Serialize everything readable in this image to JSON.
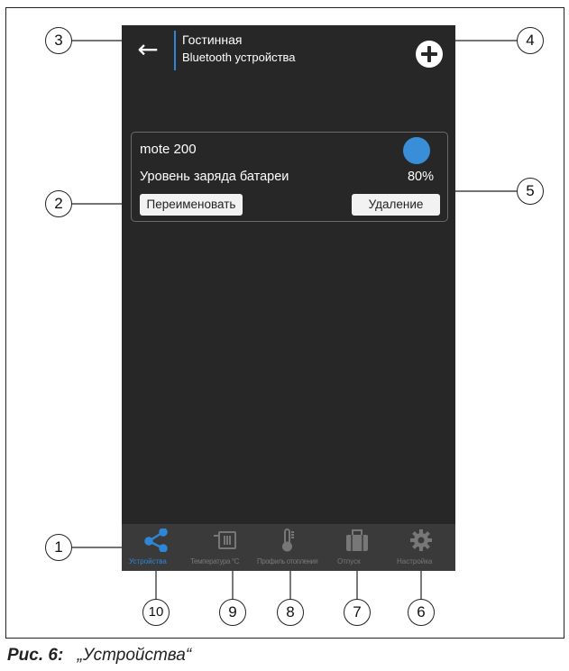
{
  "header": {
    "title": "Гостинная",
    "subtitle": "Bluetooth устройства"
  },
  "device": {
    "name": "mote 200",
    "battery_label": "Уровень заряда батареи",
    "battery_value": "80%",
    "rename_label": "Переименовать",
    "delete_label": "Удаление",
    "status_color": "#3a8ed8"
  },
  "nav": {
    "items": [
      {
        "label": "Устройства",
        "icon": "share-nodes-icon",
        "active": true
      },
      {
        "label": "Температура °C",
        "icon": "heater-icon",
        "active": false
      },
      {
        "label": "Профиль отопления",
        "icon": "thermometer-icon",
        "active": false
      },
      {
        "label": "Отпуск",
        "icon": "suitcase-icon",
        "active": false
      },
      {
        "label": "Настройка",
        "icon": "gear-icon",
        "active": false
      }
    ]
  },
  "callouts": [
    "1",
    "2",
    "3",
    "4",
    "5",
    "6",
    "7",
    "8",
    "9",
    "10"
  ],
  "caption": {
    "label": "Рис. 6:",
    "text": "„Устройства“"
  },
  "colors": {
    "accent": "#2f86d6",
    "screen_bg": "#272727",
    "nav_bg": "#3a3a3a"
  }
}
